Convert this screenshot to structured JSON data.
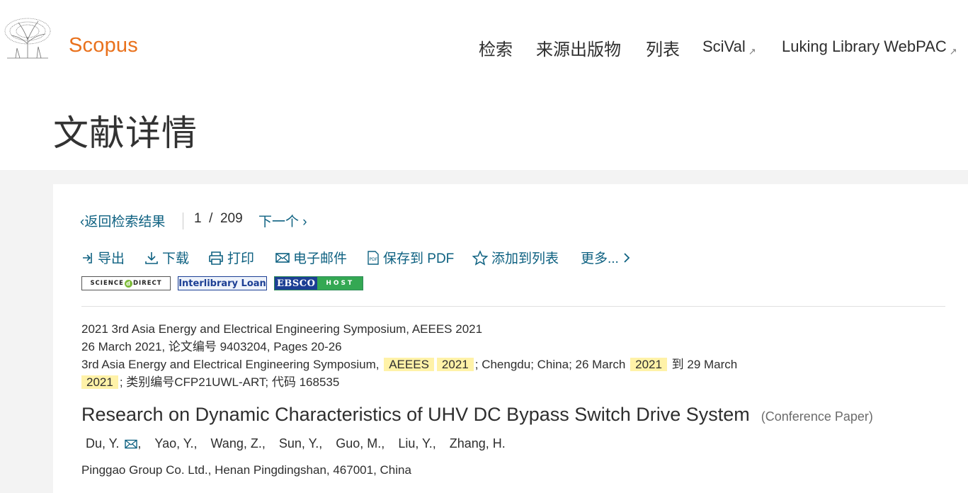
{
  "header": {
    "brand": "Scopus",
    "nav": [
      {
        "label": "检索"
      },
      {
        "label": "来源出版物"
      },
      {
        "label": "列表"
      },
      {
        "label": "SciVal",
        "external_icon": "external-link-icon"
      },
      {
        "label": "Luking Library WebPAC",
        "external_icon": "external-link-icon"
      }
    ]
  },
  "page_title": "文献详情",
  "result_nav": {
    "back_label": "返回检索结果",
    "current": "1",
    "separator": "/",
    "total": "209",
    "next_label": "下一个"
  },
  "actions": [
    {
      "label": "导出",
      "icon": "export-icon"
    },
    {
      "label": "下载",
      "icon": "download-icon"
    },
    {
      "label": "打印",
      "icon": "print-icon"
    },
    {
      "label": "电子邮件",
      "icon": "email-icon"
    },
    {
      "label": "保存到 PDF",
      "icon": "pdf-icon"
    },
    {
      "label": "添加到列表",
      "icon": "star-icon"
    },
    {
      "label": "更多...",
      "icon": "chevron-right-icon"
    }
  ],
  "badges": {
    "sciencedirect_pre": "SCIENCE",
    "sciencedirect_post": "DIRECT",
    "interlibrary": "Interlibrary Loan",
    "ebsco_1": "EBSCO",
    "ebsco_2": "HOST"
  },
  "source": {
    "line1": "2021 3rd Asia Energy and Electrical Engineering Symposium, AEEES 2021",
    "line2": "26 March 2021, 论文编号 9403204, Pages 20-26",
    "line3_a": "3rd Asia Energy and Electrical Engineering Symposium, ",
    "hl_1": "AEEES",
    "hl_2": "2021",
    "line3_b": "; Chengdu; China; 26 March ",
    "hl_3": "2021",
    "line3_c": " 到 29 March",
    "hl_4": "2021",
    "line4_b": "; 类别编号CFP21UWL-ART; 代码 168535"
  },
  "document": {
    "title": "Research on Dynamic Characteristics of UHV DC Bypass Switch Drive System",
    "type": "(Conference Paper)"
  },
  "authors": [
    {
      "name": "Du, Y.",
      "email_icon": "email-icon"
    },
    {
      "name": "Yao, Y.,"
    },
    {
      "name": "Wang, Z.,"
    },
    {
      "name": "Sun, Y.,"
    },
    {
      "name": "Guo, M.,"
    },
    {
      "name": "Liu, Y.,"
    },
    {
      "name": "Zhang, H."
    }
  ],
  "affiliation": "Pinggao Group Co. Ltd., Henan Pingdingshan, 467001, China",
  "colors": {
    "brand_orange": "#e9711c",
    "link_blue": "#0e6181",
    "highlight": "#fff2a8",
    "band_grey": "#f3f3f3"
  }
}
